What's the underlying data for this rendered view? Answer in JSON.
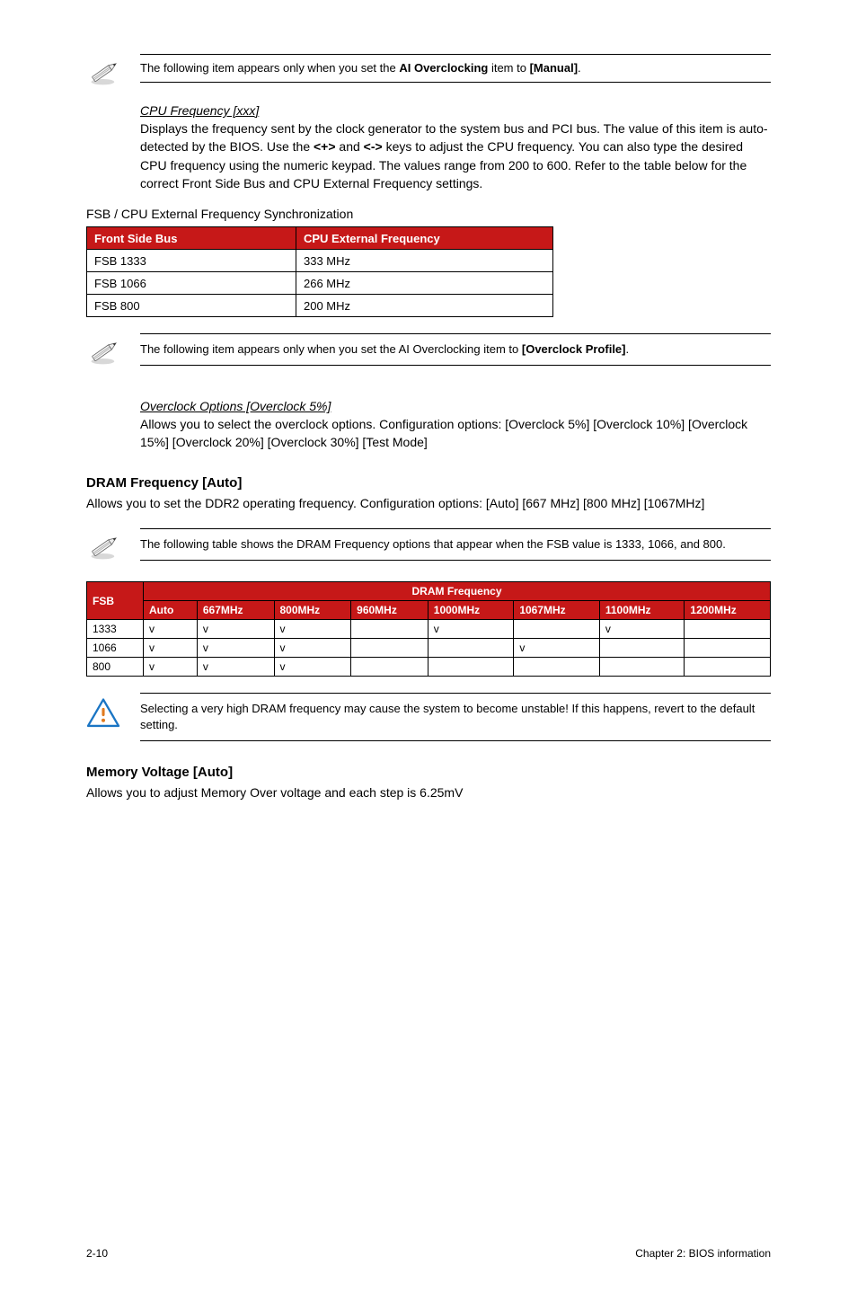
{
  "note1": {
    "pre": "The following item appears only when you set the ",
    "bold": "AI Overclocking",
    "mid": " item to ",
    "bold2": "[Manual]",
    "post": "."
  },
  "cpuFreq": {
    "label": "CPU Frequency [xxx]",
    "text": "Displays the frequency sent by the clock generator to the system bus and PCI bus. The value of this item is auto-detected by the BIOS. Use the <+> and <-> keys to adjust the CPU frequency. You can also type the desired CPU frequency using the numeric keypad. The values range from 200 to 600. Refer to the table below for the correct Front Side Bus and CPU External Frequency settings."
  },
  "fsbSyncTitle": "FSB / CPU External Frequency Synchronization",
  "fsbTable": {
    "hdr1": "Front Side Bus",
    "hdr2": "CPU External Frequency",
    "rows": [
      {
        "c1": "FSB 1333",
        "c2": "333 MHz"
      },
      {
        "c1": "FSB 1066",
        "c2": "266 MHz"
      },
      {
        "c1": "FSB 800",
        "c2": "200 MHz"
      }
    ]
  },
  "note2": {
    "pre": "The following item appears only when you set the AI Overclocking item to ",
    "bold": "[Overclock Profile]",
    "post": "."
  },
  "overclock": {
    "label": "Overclock Options [Overclock 5%]",
    "text": "Allows you to select the overclock options. Configuration options: [Overclock 5%] [Overclock 10%] [Overclock 15%] [Overclock 20%] [Overclock 30%] [Test Mode]"
  },
  "dramFreq": {
    "title": "DRAM Frequency [Auto]",
    "text": "Allows you to set the DDR2 operating frequency. Configuration options: [Auto] [667 MHz] [800 MHz] [1067MHz]"
  },
  "note3": "The following table shows the DRAM Frequency options that appear when the FSB value is 1333, 1066, and 800.",
  "dramTable": {
    "fsbHdr": "FSB",
    "title": "DRAM Frequency",
    "cols": [
      "Auto",
      "667MHz",
      "800MHz",
      "960MHz",
      "1000MHz",
      "1067MHz",
      "1100MHz",
      "1200MHz"
    ],
    "rows": [
      {
        "fsb": "1333",
        "v": [
          "v",
          "v",
          "v",
          "",
          "v",
          "",
          "v",
          ""
        ]
      },
      {
        "fsb": "1066",
        "v": [
          "v",
          "v",
          "v",
          "",
          "",
          "v",
          "",
          ""
        ]
      },
      {
        "fsb": "800",
        "v": [
          "v",
          "v",
          "v",
          "",
          "",
          "",
          "",
          ""
        ]
      }
    ]
  },
  "warn": "Selecting a very high DRAM frequency may cause the system to become unstable! If this happens, revert to the default setting.",
  "memVolt": {
    "title": "Memory Voltage [Auto]",
    "text": "Allows you to adjust Memory Over voltage and each step is 6.25mV"
  },
  "footer": {
    "left": "2-10",
    "right": "Chapter 2: BIOS information"
  }
}
